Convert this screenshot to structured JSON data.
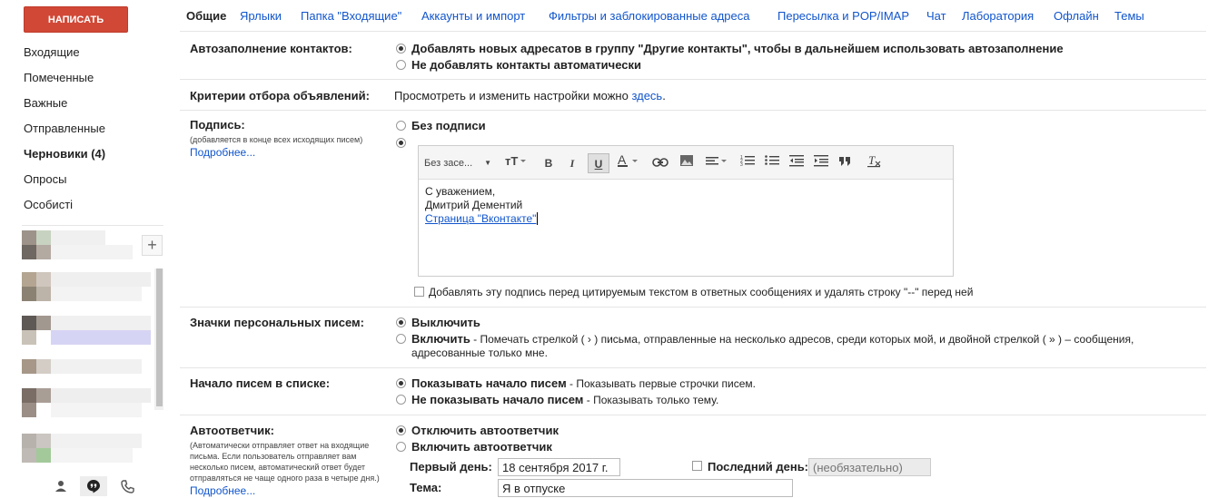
{
  "sidebar": {
    "compose_label": "НАПИСАТЬ",
    "items": [
      {
        "label": "Входящие"
      },
      {
        "label": "Помеченные"
      },
      {
        "label": "Важные"
      },
      {
        "label": "Отправленные"
      },
      {
        "label": "Черновики (4)"
      },
      {
        "label": "Опросы"
      },
      {
        "label": "Особисті"
      }
    ],
    "add_label": "+"
  },
  "tabs": [
    {
      "label": "Общие"
    },
    {
      "label": "Ярлыки"
    },
    {
      "label": "Папка \"Входящие\""
    },
    {
      "label": "Аккаунты и импорт"
    },
    {
      "label": "Фильтры и заблокированные адреса"
    },
    {
      "label": "Пересылка и POP/IMAP"
    },
    {
      "label": "Чат"
    },
    {
      "label": "Лаборатория"
    },
    {
      "label": "Офлайн"
    },
    {
      "label": "Темы"
    }
  ],
  "autocomplete": {
    "label": "Автозаполнение контактов:",
    "opt1": "Добавлять новых адресатов в группу \"Другие контакты\", чтобы в дальнейшем использовать автозаполнение",
    "opt2": "Не добавлять контакты автоматически"
  },
  "ads": {
    "label": "Критерии отбора объявлений:",
    "text": "Просмотреть и изменить настройки можно ",
    "link": "здесь",
    "tail": "."
  },
  "signature": {
    "label": "Подпись:",
    "sublabel": "(добавляется в конце всех исходящих писем)",
    "more": "Подробнее...",
    "opt_none": "Без подписи",
    "font_select": "Без засе...",
    "body_line1": "С уважением,",
    "body_line2": "Дмитрий Дементий",
    "body_link": "Страница \"Вконтакте\"",
    "checkbox_label": "Добавлять эту подпись перед цитируемым текстом в ответных сообщениях и удалять строку \"--\" перед ней"
  },
  "personal": {
    "label": "Значки персональных писем:",
    "opt1": "Выключить",
    "opt2_bold": "Включить",
    "opt2_text": " - Помечать стрелкой ( › ) письма, отправленные на несколько адресов, среди которых мой, и двойной стрелкой ( » ) – сообщения,",
    "opt2_line2": "адресованные только мне."
  },
  "snippets": {
    "label": "Начало писем в списке:",
    "opt1_bold": "Показывать начало писем",
    "opt1_text": " - Показывать первые строчки писем.",
    "opt2_bold": "Не показывать начало писем",
    "opt2_text": " - Показывать только тему."
  },
  "vacation": {
    "label": "Автоответчик:",
    "sublabel_l1": "(Автоматически отправляет ответ на входящие",
    "sublabel_l2": "письма. Если пользователь отправляет вам",
    "sublabel_l3": "несколько писем, автоматический ответ будет",
    "sublabel_l4": "отправляться не чаще одного раза в четыре дня.)",
    "more": "Подробнее...",
    "opt_off": "Отключить автоответчик",
    "opt_on": "Включить автоответчик",
    "first_day_label": "Первый день:",
    "first_day_value": "18 сентября 2017 г.",
    "last_day_label": "Последний день:",
    "last_day_placeholder": "(необязательно)",
    "subject_label": "Тема:",
    "subject_value": "Я в отпуске"
  }
}
